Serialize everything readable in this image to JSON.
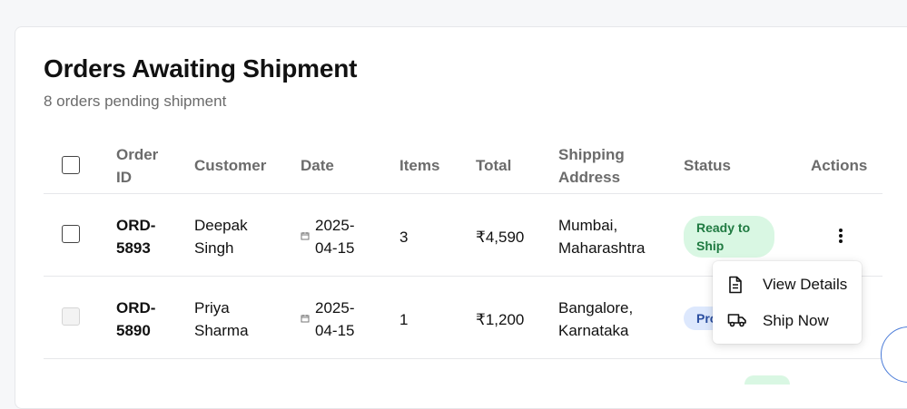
{
  "page": {
    "title": "Orders Awaiting Shipment",
    "subtitle": "8 orders pending shipment"
  },
  "table": {
    "headers": {
      "order_id": "Order\nID",
      "customer": "Customer",
      "date": "Date",
      "items": "Items",
      "total": "Total",
      "shipping_address": "Shipping\nAddress",
      "status": "Status",
      "actions": "Actions"
    },
    "rows": [
      {
        "order_id": "ORD-\n5893",
        "customer": "Deepak\nSingh",
        "date": "2025-\n04-15",
        "items": "3",
        "total": "₹4,590",
        "address": "Mumbai,\nMaharashtra",
        "status": "Ready to\nShip"
      },
      {
        "order_id": "ORD-\n5890",
        "customer": "Priya\nSharma",
        "date": "2025-\n04-15",
        "items": "1",
        "total": "₹1,200",
        "address": "Bangalore,\nKarnataka",
        "status": "Pro"
      }
    ]
  },
  "actions_menu": {
    "items": [
      {
        "label": "View Details",
        "icon": "document-icon"
      },
      {
        "label": "Ship Now",
        "icon": "truck-icon"
      }
    ]
  },
  "colors": {
    "ready_badge_bg": "#d9f7e3",
    "ready_badge_text": "#1f7a41",
    "processing_badge_bg": "#dde8fd",
    "processing_badge_text": "#2a4ea0"
  }
}
